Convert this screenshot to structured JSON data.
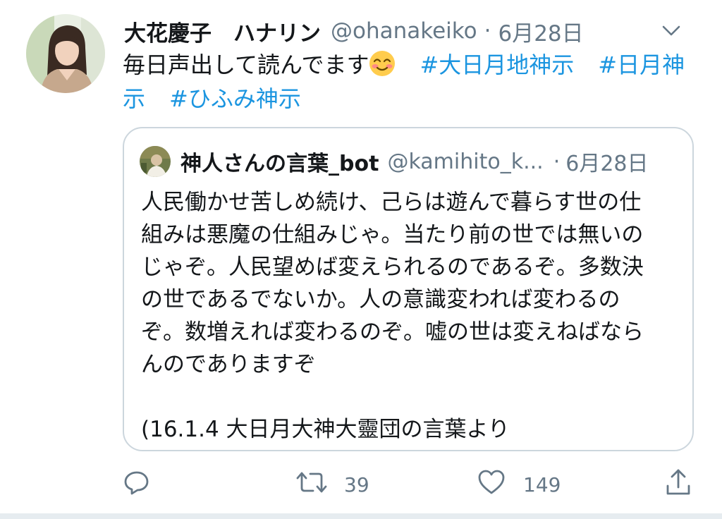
{
  "tweet": {
    "display_name": "大花慶子　ハナリン",
    "handle": "@ohanakeiko",
    "separator": "·",
    "date": "6月28日",
    "text": "毎日声出して読んでます",
    "emoji_icon": "smiling-face-emoji",
    "hashtags": [
      "#大日月地神示",
      "#日月神示",
      "#ひふみ神示"
    ],
    "hashtag_color": "#1b95e0"
  },
  "quote": {
    "display_name": "神人さんの言葉_bot",
    "handle": "@kamihito_k...",
    "separator": "·",
    "date": "6月28日",
    "lines": [
      "人民働かせ苦しめ続け、己らは遊んで暮らす世の仕",
      "組みは悪魔の仕組みじゃ。当たり前の世では無いの",
      "じゃぞ。人民望めば変えられるのであるぞ。多数決",
      "の世であるでないか。人の意識変われば変わるの",
      "ぞ。数増えれば変わるのぞ。嘘の世は変えねばなら",
      "んのでありますぞ"
    ],
    "source_line": "(16.1.4 大日月大神大靈団の言葉より"
  },
  "actions": {
    "reply_icon": "reply-icon",
    "retweet_icon": "retweet-icon",
    "retweet_count": "39",
    "like_icon": "heart-icon",
    "like_count": "149",
    "share_icon": "share-icon"
  }
}
